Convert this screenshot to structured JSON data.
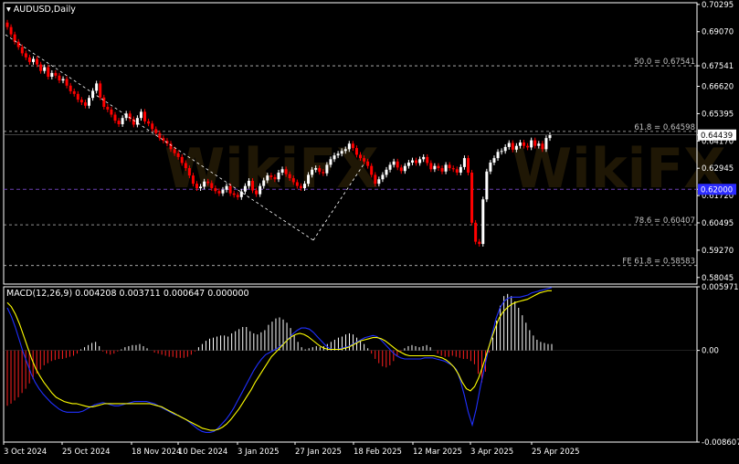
{
  "symbol": "AUDUSD,Daily",
  "macd_label": "MACD(12,26,9) 0.004208 0.003711 0.000647 0.000000",
  "watermark": "WikiFX",
  "colors": {
    "background": "#000000",
    "axis": "#ffffff",
    "bull": "#ffffff",
    "bear": "#ff0000",
    "fib_line": "#c0c0c0",
    "level_line": "#6b3fb0",
    "price_tag_bg": "#ffffff",
    "level_tag_bg": "#2a2aff",
    "macd_pos": "#ffffff",
    "macd_neg": "#ff2020",
    "macd_line": "#2030ff",
    "signal_line": "#ffff00"
  },
  "chart_data": [
    {
      "type": "candlestick",
      "title": "AUDUSD,Daily",
      "y_ticks": [
        "0.70295",
        "0.69070",
        "0.67541",
        "0.66620",
        "0.65395",
        "0.64439",
        "0.64170",
        "0.62945",
        "0.62000",
        "0.61720",
        "0.60495",
        "0.59270",
        "0.58045"
      ],
      "ylim": [
        0.5775,
        0.7037
      ],
      "x_ticks": [
        "3 Oct 2024",
        "25 Oct 2024",
        "18 Nov 2024",
        "10 Dec 2024",
        "3 Jan 2025",
        "27 Jan 2025",
        "18 Feb 2025",
        "12 Mar 2025",
        "3 Apr 2025",
        "25 Apr 2025"
      ],
      "current_price": "0.64439",
      "horizontal_level": "0.62000",
      "fib_levels": [
        {
          "label": "50.0 = 0.67541",
          "value": 0.67541
        },
        {
          "label": "61.8 = 0.64598",
          "value": 0.64598
        },
        {
          "label": "78.6 = 0.60407",
          "value": 0.60407
        },
        {
          "label": "FE 61.8 = 0.58583",
          "value": 0.58583
        }
      ],
      "close": [
        0.6928,
        0.6895,
        0.6862,
        0.6838,
        0.681,
        0.6792,
        0.6771,
        0.6785,
        0.676,
        0.6731,
        0.6748,
        0.6705,
        0.6722,
        0.671,
        0.6688,
        0.6695,
        0.6665,
        0.664,
        0.6628,
        0.6602,
        0.659,
        0.6575,
        0.661,
        0.6642,
        0.6675,
        0.6612,
        0.657,
        0.6558,
        0.6535,
        0.6508,
        0.6492,
        0.652,
        0.654,
        0.6515,
        0.649,
        0.652,
        0.6548,
        0.6505,
        0.6495,
        0.647,
        0.6452,
        0.643,
        0.6418,
        0.6405,
        0.638,
        0.6362,
        0.6345,
        0.6318,
        0.6295,
        0.6262,
        0.6225,
        0.6205,
        0.6212,
        0.6235,
        0.6228,
        0.6205,
        0.6192,
        0.6182,
        0.6198,
        0.6215,
        0.6182,
        0.6175,
        0.6165,
        0.619,
        0.6215,
        0.6238,
        0.6195,
        0.6178,
        0.6215,
        0.624,
        0.6262,
        0.6255,
        0.6245,
        0.6275,
        0.629,
        0.6268,
        0.625,
        0.6232,
        0.6215,
        0.6205,
        0.6225,
        0.6265,
        0.6288,
        0.6295,
        0.6278,
        0.6272,
        0.631,
        0.6335,
        0.6352,
        0.636,
        0.6372,
        0.638,
        0.6405,
        0.6385,
        0.6355,
        0.634,
        0.6325,
        0.6305,
        0.6265,
        0.6225,
        0.6245,
        0.6265,
        0.6288,
        0.631,
        0.6325,
        0.6298,
        0.6282,
        0.6305,
        0.632,
        0.633,
        0.6318,
        0.6335,
        0.6345,
        0.6318,
        0.629,
        0.6305,
        0.6295,
        0.628,
        0.631,
        0.6295,
        0.629,
        0.6275,
        0.63,
        0.634,
        0.6275,
        0.605,
        0.5965,
        0.5955,
        0.6155,
        0.628,
        0.632,
        0.634,
        0.6368,
        0.6372,
        0.639,
        0.6408,
        0.6378,
        0.6395,
        0.641,
        0.6395,
        0.6388,
        0.642,
        0.6395,
        0.6405,
        0.638,
        0.643,
        0.6444
      ],
      "macd_hist": [
        -0.0052,
        -0.005,
        -0.0047,
        -0.0044,
        -0.004,
        -0.0036,
        -0.0031,
        -0.0027,
        -0.0022,
        -0.0018,
        -0.0014,
        -0.0012,
        -0.001,
        -0.0009,
        -0.0008,
        -0.0008,
        -0.0007,
        -0.0006,
        -0.0005,
        -0.0003,
        0.0001,
        0.0003,
        0.0005,
        0.0007,
        0.0008,
        0.0004,
        -0.0001,
        -0.0003,
        -0.0004,
        -0.0003,
        -0.0001,
        0.0001,
        0.0003,
        0.0004,
        0.0005,
        0.0005,
        0.0006,
        0.0004,
        0.0002,
        0.0,
        -0.0002,
        -0.0003,
        -0.0004,
        -0.0005,
        -0.0006,
        -0.0006,
        -0.0007,
        -0.0007,
        -0.0007,
        -0.0006,
        -0.0004,
        -0.0001,
        0.0003,
        0.0006,
        0.0009,
        0.0011,
        0.0012,
        0.0013,
        0.0014,
        0.0014,
        0.0013,
        0.0016,
        0.0018,
        0.002,
        0.0022,
        0.0022,
        0.0018,
        0.0016,
        0.0015,
        0.0017,
        0.0019,
        0.0024,
        0.0027,
        0.003,
        0.0031,
        0.0029,
        0.0026,
        0.0021,
        0.0014,
        0.0008,
        0.0003,
        0.0001,
        0.0002,
        0.0003,
        0.0004,
        0.0003,
        0.0004,
        0.0006,
        0.0008,
        0.001,
        0.0012,
        0.0013,
        0.0015,
        0.0016,
        0.0015,
        0.0012,
        0.0009,
        0.0006,
        0.0002,
        -0.0003,
        -0.0008,
        -0.0012,
        -0.0015,
        -0.0016,
        -0.0014,
        -0.001,
        -0.0005,
        -0.0001,
        0.0002,
        0.0004,
        0.0005,
        0.0004,
        0.0003,
        0.0004,
        0.0005,
        0.0003,
        0.0,
        -0.0003,
        -0.0005,
        -0.0006,
        -0.0006,
        -0.0005,
        -0.0006,
        -0.0007,
        -0.0008,
        -0.0008,
        -0.001,
        -0.0013,
        -0.0022,
        -0.003,
        -0.002,
        -0.0002,
        0.0012,
        0.0028,
        0.0042,
        0.0051,
        0.0053,
        0.0051,
        0.0046,
        0.004,
        0.0033,
        0.0026,
        0.0019,
        0.0014,
        0.001,
        0.0008,
        0.0007,
        0.0006,
        0.0006
      ],
      "macd_line": [
        0.004,
        0.0032,
        0.0022,
        0.001,
        -0.0002,
        -0.0012,
        -0.0022,
        -0.003,
        -0.0036,
        -0.0041,
        -0.0045,
        -0.0049,
        -0.0052,
        -0.0055,
        -0.0057,
        -0.0058,
        -0.0058,
        -0.0058,
        -0.0058,
        -0.0057,
        -0.0055,
        -0.0053,
        -0.0051,
        -0.005,
        -0.0049,
        -0.005,
        -0.0051,
        -0.0052,
        -0.0052,
        -0.0051,
        -0.005,
        -0.0049,
        -0.0048,
        -0.0048,
        -0.0048,
        -0.0048,
        -0.0049,
        -0.005,
        -0.0052,
        -0.0054,
        -0.0056,
        -0.0058,
        -0.006,
        -0.0061,
        -0.0063,
        -0.0065,
        -0.0068,
        -0.0071,
        -0.0074,
        -0.0076,
        -0.0077,
        -0.0077,
        -0.0076,
        -0.0073,
        -0.0069,
        -0.0065,
        -0.006,
        -0.0054,
        -0.0047,
        -0.004,
        -0.0033,
        -0.0026,
        -0.0019,
        -0.0013,
        -0.0008,
        -0.0004,
        -0.0002,
        0.0,
        0.0002,
        0.0005,
        0.0008,
        0.0012,
        0.0016,
        0.0019,
        0.0021,
        0.0021,
        0.002,
        0.0017,
        0.0013,
        0.0009,
        0.0005,
        0.0002,
        0.0001,
        0.0001,
        0.0002,
        0.0003,
        0.0004,
        0.0006,
        0.0008,
        0.001,
        0.0012,
        0.0013,
        0.0014,
        0.0013,
        0.001,
        0.0006,
        0.0002,
        -0.0002,
        -0.0005,
        -0.0007,
        -0.0008,
        -0.0008,
        -0.0008,
        -0.0008,
        -0.0008,
        -0.0007,
        -0.0007,
        -0.0007,
        -0.0008,
        -0.0009,
        -0.001,
        -0.0012,
        -0.0014,
        -0.0018,
        -0.0028,
        -0.0042,
        -0.0058,
        -0.007,
        -0.0055,
        -0.0035,
        -0.0018,
        0.0,
        0.0015,
        0.003,
        0.004,
        0.0046,
        0.0049,
        0.005,
        0.005,
        0.005,
        0.0051,
        0.0052,
        0.0054,
        0.0055,
        0.0056,
        0.0057,
        0.0058,
        0.0059
      ],
      "signal_line": [
        0.0045,
        0.0041,
        0.0034,
        0.0025,
        0.0014,
        0.0003,
        -0.0008,
        -0.0017,
        -0.0024,
        -0.003,
        -0.0035,
        -0.004,
        -0.0044,
        -0.0046,
        -0.0048,
        -0.0049,
        -0.005,
        -0.005,
        -0.0051,
        -0.0052,
        -0.0053,
        -0.0053,
        -0.0052,
        -0.0051,
        -0.005,
        -0.005,
        -0.005,
        -0.005,
        -0.005,
        -0.005,
        -0.005,
        -0.005,
        -0.005,
        -0.005,
        -0.005,
        -0.005,
        -0.0051,
        -0.0052,
        -0.0053,
        -0.0055,
        -0.0057,
        -0.0059,
        -0.0061,
        -0.0063,
        -0.0065,
        -0.0067,
        -0.0069,
        -0.0071,
        -0.0073,
        -0.0074,
        -0.0075,
        -0.0075,
        -0.0074,
        -0.0072,
        -0.0069,
        -0.0065,
        -0.006,
        -0.0055,
        -0.0049,
        -0.0043,
        -0.0037,
        -0.003,
        -0.0024,
        -0.0018,
        -0.0012,
        -0.0006,
        -0.0002,
        0.0002,
        0.0006,
        0.001,
        0.0013,
        0.0015,
        0.0016,
        0.0015,
        0.0013,
        0.001,
        0.0007,
        0.0004,
        0.0002,
        0.0001,
        0.0001,
        0.0001,
        0.0001,
        0.0002,
        0.0003,
        0.0005,
        0.0007,
        0.0009,
        0.001,
        0.0011,
        0.0012,
        0.0012,
        0.0011,
        0.0009,
        0.0006,
        0.0003,
        0.0,
        -0.0002,
        -0.0004,
        -0.0005,
        -0.0005,
        -0.0005,
        -0.0005,
        -0.0005,
        -0.0005,
        -0.0005,
        -0.0006,
        -0.0007,
        -0.0009,
        -0.0012,
        -0.0016,
        -0.0022,
        -0.003,
        -0.0036,
        -0.0038,
        -0.0034,
        -0.0026,
        -0.0015,
        -0.0003,
        0.0009,
        0.002,
        0.003,
        0.0036,
        0.004,
        0.0043,
        0.0045,
        0.0046,
        0.0047,
        0.0048,
        0.005,
        0.0052,
        0.0054,
        0.0055,
        0.0056,
        0.0056
      ],
      "macd_y_ticks": [
        "0.005971",
        "0.00",
        "-0.008607"
      ],
      "macd_ylim": [
        -0.008607,
        0.005971
      ]
    }
  ]
}
